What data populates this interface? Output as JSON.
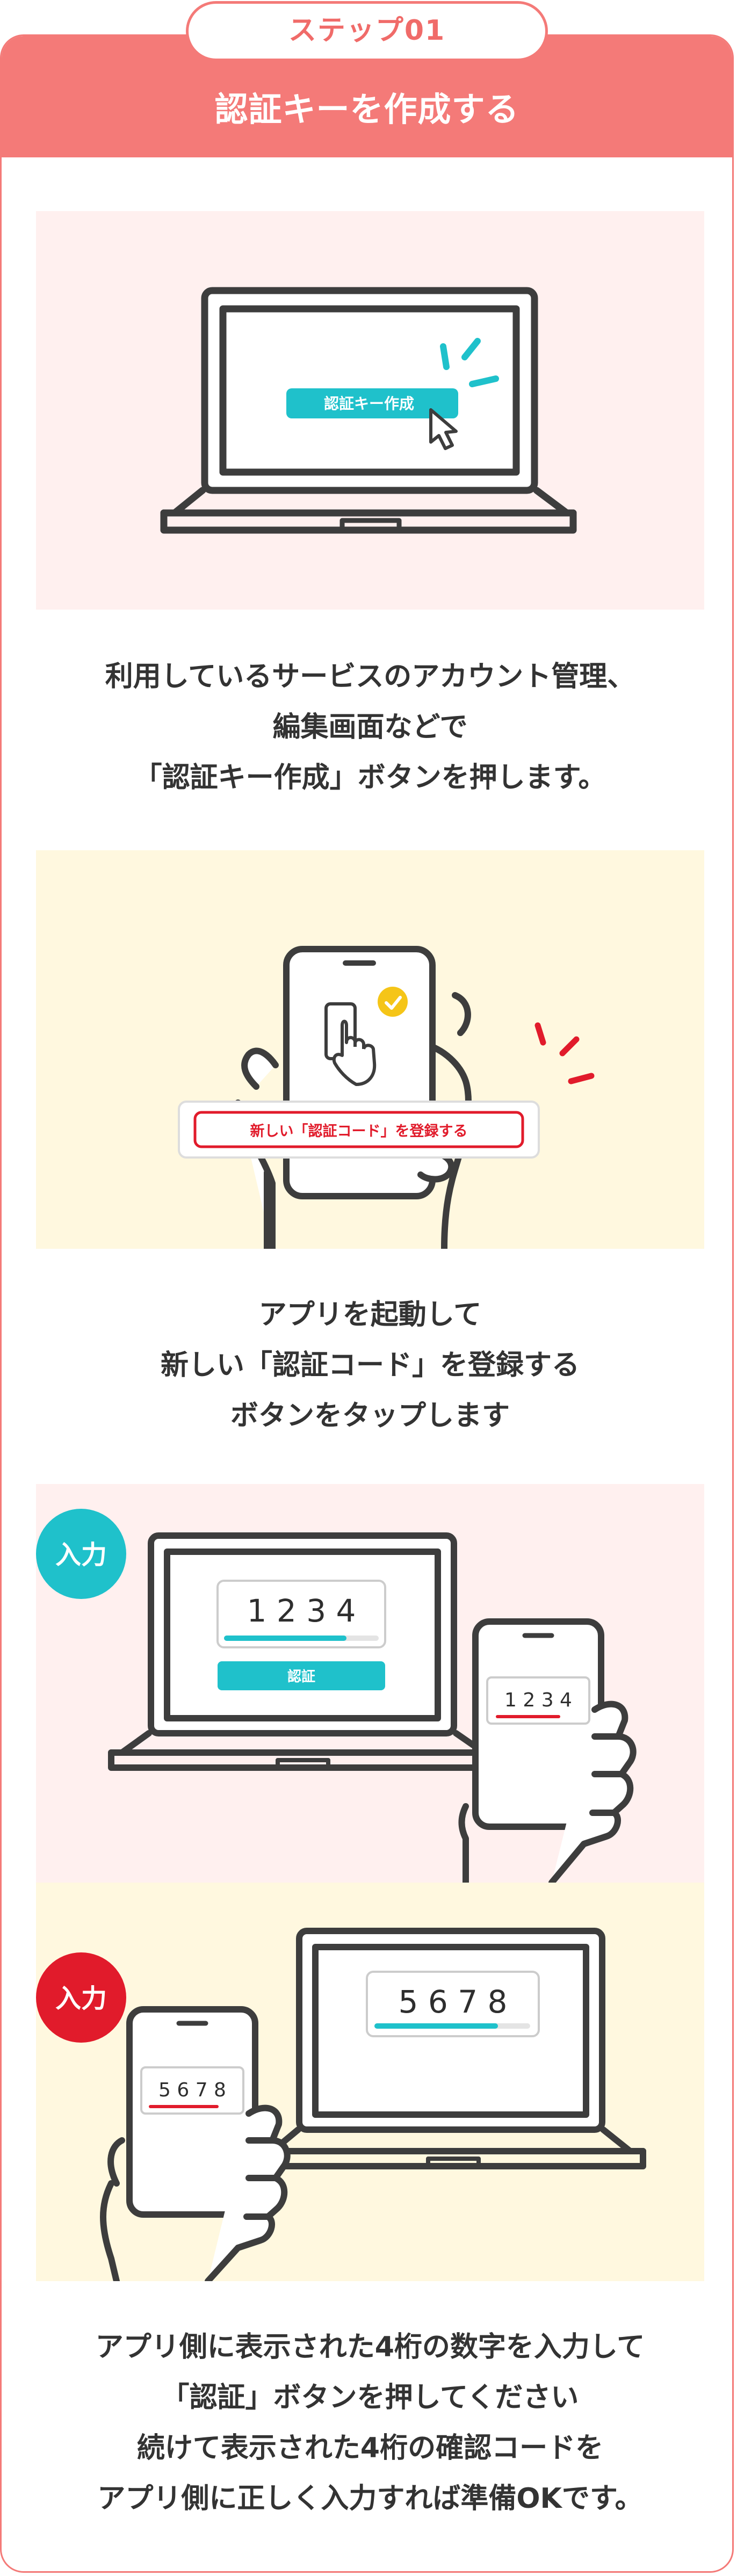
{
  "header": {
    "step_label": "ステップ01",
    "title": "認証キーを作成する"
  },
  "step1": {
    "button_label": "認証キー作成",
    "caption_lines": [
      "利用しているサービスのアカウント管理、",
      "編集画面などで",
      "「認証キー作成」ボタンを押します。"
    ]
  },
  "step2": {
    "button_label": "新しい「認証コード」を登録する",
    "caption_lines": [
      "アプリを起動して",
      "新しい「認証コード」を登録する",
      "ボタンをタップします"
    ]
  },
  "step3": {
    "input_badge": "入力",
    "pc_code": "1 2 3 4",
    "pc_button_label": "認証",
    "phone_code": "1 2 3 4"
  },
  "step4": {
    "input_badge": "入力",
    "pc_code": "5 6 7 8",
    "phone_code": "5 6 7 8",
    "caption_lines": [
      "アプリ側に表示された4桁の数字を入力して",
      "「認証」ボタンを押してください",
      "続けて表示された4桁の確認コードを",
      "アプリ側に正しく入力すれば準備OKです。"
    ]
  },
  "colors": {
    "accent_pink": "#f47a78",
    "teal": "#1fc1cb",
    "red": "#e11b2b",
    "outline": "#3d3d3d",
    "pink_bg": "#fff0ef",
    "yellow_bg": "#fff8df"
  }
}
